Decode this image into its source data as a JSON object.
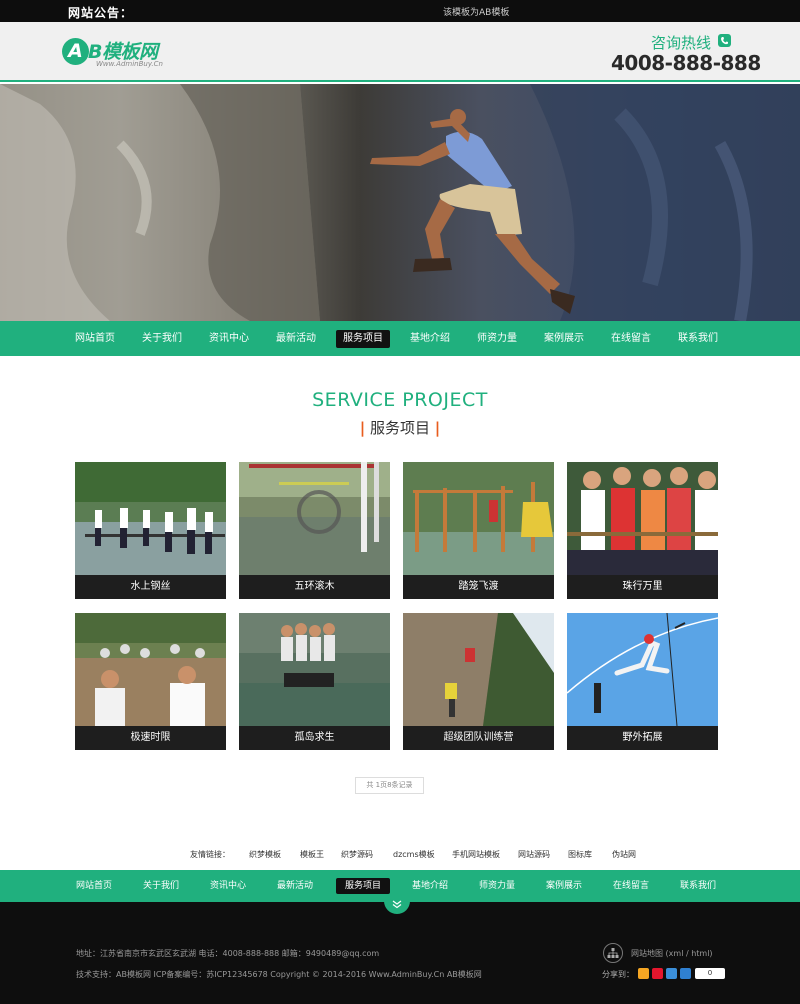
{
  "topbar": {
    "notice_label": "网站公告：",
    "notice_text": "该模板为AB模板"
  },
  "header": {
    "logo_mark": "A",
    "logo_text": "B模板网",
    "logo_sub": "Www.AdminBuy.Cn",
    "hotline_label": "咨询热线",
    "hotline_number": "4008-888-888"
  },
  "nav": {
    "items": [
      "网站首页",
      "关于我们",
      "资讯中心",
      "最新活动",
      "服务项目",
      "基地介绍",
      "师资力量",
      "案例展示",
      "在线留言",
      "联系我们"
    ],
    "active_index": 4
  },
  "section": {
    "title_en": "SERVICE PROJECT",
    "title_cn": "服务项目"
  },
  "cards": [
    {
      "caption": "水上钢丝"
    },
    {
      "caption": "五环滚木"
    },
    {
      "caption": "踏笼飞渡"
    },
    {
      "caption": "珠行万里"
    },
    {
      "caption": "极速时限"
    },
    {
      "caption": "孤岛求生"
    },
    {
      "caption": "超级团队训练营"
    },
    {
      "caption": "野外拓展"
    }
  ],
  "pager": {
    "text": "共 1页8条记录"
  },
  "links": {
    "label": "友情链接：",
    "items": [
      "织梦模板",
      "模板王",
      "织梦源码",
      "dzcms模板",
      "手机网站模板",
      "网站源码",
      "图标库",
      "伪站网"
    ]
  },
  "footer": {
    "address": "地址：江苏省南京市玄武区玄武湖  电话：4008-888-888  邮箱：9490489@qq.com",
    "copyright": "技术支持：AB模板网  ICP备案编号：苏ICP12345678 Copyright © 2014-2016 Www.AdminBuy.Cn AB模板网",
    "sitemap": "网站地图 (xml / html)",
    "share_label": "分享到：",
    "share_count": "0"
  },
  "colors": {
    "brand_green": "#20b07e",
    "accent_orange": "#e85d1e",
    "dark": "#0e0e0e"
  }
}
